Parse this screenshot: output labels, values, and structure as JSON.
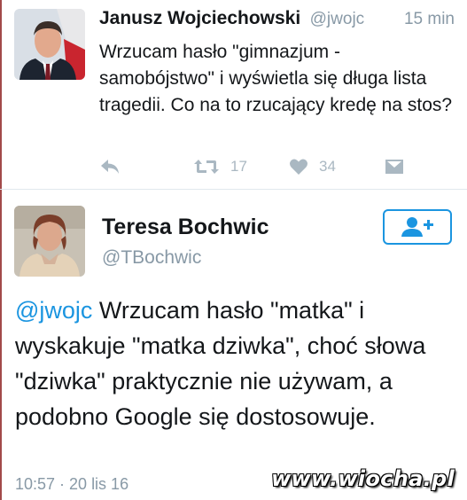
{
  "tweet1": {
    "author_name": "Janusz Wojciechowski",
    "author_handle": "@jwojc",
    "time": "15 min",
    "text": "Wrzucam hasło \"gimnazjum - samobójstwo\" i wyświetla się długa lista tragedii. Co na to rzucający kredę na stos?",
    "retweets": "17",
    "likes": "34",
    "icons": [
      "reply-icon",
      "retweet-icon",
      "heart-icon",
      "direct-message-icon"
    ]
  },
  "tweet2": {
    "author_name": "Teresa Bochwic",
    "author_handle": "@TBochwic",
    "mention": "@jwojc",
    "text": " Wrzucam hasło \"matka\" i wyskakuje \"matka dziwka\", choć słowa \"dziwka\" praktycznie nie używam, a podobno Google się dostosowuje.",
    "timestamp": "10:57 · 20 lis 16",
    "follow_icon": "follow-user-icon"
  },
  "watermark": "www.wiocha.pl",
  "colors": {
    "text": "#14171a",
    "secondary": "#8899a6",
    "action": "#aab8c2",
    "accent": "#1b95e0",
    "divider": "#e1e8ed"
  }
}
